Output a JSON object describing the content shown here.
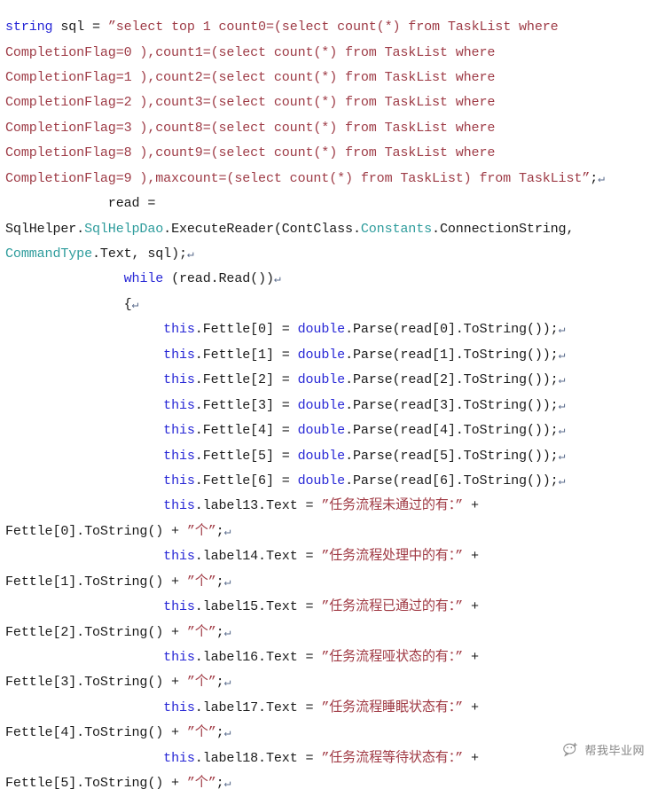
{
  "document": {
    "kind": "source-code-listing",
    "language": "C#",
    "background_color": "#ffffff",
    "colors": {
      "keyword": "#2727d6",
      "string_literal": "#9e3b46",
      "chinese_string": "#a03a44",
      "class_name": "#2e9c9c",
      "plain_text": "#1a1a1a",
      "pilcrow_mark": "#5a6b8c"
    }
  },
  "code": {
    "lines": [
      {
        "n": 1,
        "segments": [
          {
            "t": "string",
            "c": "kw"
          },
          {
            "t": " sql = ",
            "c": "plain"
          },
          {
            "t": "”select top 1 count0=(select count(*) from TaskList where",
            "c": "str"
          }
        ]
      },
      {
        "n": 2,
        "segments": [
          {
            "t": "CompletionFlag=0 ),count1=(select count(*) from TaskList where",
            "c": "str"
          }
        ]
      },
      {
        "n": 3,
        "segments": [
          {
            "t": "CompletionFlag=1 ),count2=(select count(*) from TaskList where",
            "c": "str"
          }
        ]
      },
      {
        "n": 4,
        "segments": [
          {
            "t": "CompletionFlag=2 ),count3=(select count(*) from TaskList where",
            "c": "str"
          }
        ]
      },
      {
        "n": 5,
        "segments": [
          {
            "t": "CompletionFlag=3 ),count8=(select count(*) from TaskList where",
            "c": "str"
          }
        ]
      },
      {
        "n": 6,
        "segments": [
          {
            "t": "CompletionFlag=8 ),count9=(select count(*) from TaskList where",
            "c": "str"
          }
        ]
      },
      {
        "n": 7,
        "segments": [
          {
            "t": "CompletionFlag=9 ),maxcount=(select count(*) from TaskList) from TaskList”",
            "c": "str"
          },
          {
            "t": ";",
            "c": "plain"
          },
          {
            "t": "↵",
            "c": "pil"
          }
        ]
      },
      {
        "n": 8,
        "segments": [
          {
            "t": "             read = ",
            "c": "plain"
          }
        ]
      },
      {
        "n": 9,
        "segments": [
          {
            "t": "SqlHelper.",
            "c": "plain"
          },
          {
            "t": "SqlHelpDao",
            "c": "cls"
          },
          {
            "t": ".ExecuteReader(ContClass.",
            "c": "plain"
          },
          {
            "t": "Constants",
            "c": "cls"
          },
          {
            "t": ".ConnectionString,",
            "c": "plain"
          }
        ]
      },
      {
        "n": 10,
        "segments": [
          {
            "t": "CommandType",
            "c": "cls"
          },
          {
            "t": ".Text, sql);",
            "c": "plain"
          },
          {
            "t": "↵",
            "c": "pil"
          }
        ]
      },
      {
        "n": 11,
        "segments": [
          {
            "t": "               ",
            "c": "plain"
          },
          {
            "t": "while",
            "c": "kw"
          },
          {
            "t": " (read.Read())",
            "c": "plain"
          },
          {
            "t": "↵",
            "c": "pil"
          }
        ]
      },
      {
        "n": 12,
        "segments": [
          {
            "t": "               {",
            "c": "plain"
          },
          {
            "t": "↵",
            "c": "pil"
          }
        ]
      },
      {
        "n": 13,
        "segments": [
          {
            "t": "                    ",
            "c": "plain"
          },
          {
            "t": "this",
            "c": "kw"
          },
          {
            "t": ".Fettle[0] = ",
            "c": "plain"
          },
          {
            "t": "double",
            "c": "kw"
          },
          {
            "t": ".Parse(read[0].ToString());",
            "c": "plain"
          },
          {
            "t": "↵",
            "c": "pil"
          }
        ]
      },
      {
        "n": 14,
        "segments": [
          {
            "t": "                    ",
            "c": "plain"
          },
          {
            "t": "this",
            "c": "kw"
          },
          {
            "t": ".Fettle[1] = ",
            "c": "plain"
          },
          {
            "t": "double",
            "c": "kw"
          },
          {
            "t": ".Parse(read[1].ToString());",
            "c": "plain"
          },
          {
            "t": "↵",
            "c": "pil"
          }
        ]
      },
      {
        "n": 15,
        "segments": [
          {
            "t": "                    ",
            "c": "plain"
          },
          {
            "t": "this",
            "c": "kw"
          },
          {
            "t": ".Fettle[2] = ",
            "c": "plain"
          },
          {
            "t": "double",
            "c": "kw"
          },
          {
            "t": ".Parse(read[2].ToString());",
            "c": "plain"
          },
          {
            "t": "↵",
            "c": "pil"
          }
        ]
      },
      {
        "n": 16,
        "segments": [
          {
            "t": "                    ",
            "c": "plain"
          },
          {
            "t": "this",
            "c": "kw"
          },
          {
            "t": ".Fettle[3] = ",
            "c": "plain"
          },
          {
            "t": "double",
            "c": "kw"
          },
          {
            "t": ".Parse(read[3].ToString());",
            "c": "plain"
          },
          {
            "t": "↵",
            "c": "pil"
          }
        ]
      },
      {
        "n": 17,
        "segments": [
          {
            "t": "                    ",
            "c": "plain"
          },
          {
            "t": "this",
            "c": "kw"
          },
          {
            "t": ".Fettle[4] = ",
            "c": "plain"
          },
          {
            "t": "double",
            "c": "kw"
          },
          {
            "t": ".Parse(read[4].ToString());",
            "c": "plain"
          },
          {
            "t": "↵",
            "c": "pil"
          }
        ]
      },
      {
        "n": 18,
        "segments": [
          {
            "t": "                    ",
            "c": "plain"
          },
          {
            "t": "this",
            "c": "kw"
          },
          {
            "t": ".Fettle[5] = ",
            "c": "plain"
          },
          {
            "t": "double",
            "c": "kw"
          },
          {
            "t": ".Parse(read[5].ToString());",
            "c": "plain"
          },
          {
            "t": "↵",
            "c": "pil"
          }
        ]
      },
      {
        "n": 19,
        "segments": [
          {
            "t": "                    ",
            "c": "plain"
          },
          {
            "t": "this",
            "c": "kw"
          },
          {
            "t": ".Fettle[6] = ",
            "c": "plain"
          },
          {
            "t": "double",
            "c": "kw"
          },
          {
            "t": ".Parse(read[6].ToString());",
            "c": "plain"
          },
          {
            "t": "↵",
            "c": "pil"
          }
        ]
      },
      {
        "n": 20,
        "segments": [
          {
            "t": "                    ",
            "c": "plain"
          },
          {
            "t": "this",
            "c": "kw"
          },
          {
            "t": ".label13.Text = ",
            "c": "plain"
          },
          {
            "t": "”任务流程未通过的有：”",
            "c": "strcn"
          },
          {
            "t": " +",
            "c": "plain"
          }
        ]
      },
      {
        "n": 21,
        "segments": [
          {
            "t": "Fettle[0].ToString() + ",
            "c": "plain"
          },
          {
            "t": "”个”",
            "c": "strcn"
          },
          {
            "t": ";",
            "c": "plain"
          },
          {
            "t": "↵",
            "c": "pil"
          }
        ]
      },
      {
        "n": 22,
        "segments": [
          {
            "t": "                    ",
            "c": "plain"
          },
          {
            "t": "this",
            "c": "kw"
          },
          {
            "t": ".label14.Text = ",
            "c": "plain"
          },
          {
            "t": "”任务流程处理中的有：”",
            "c": "strcn"
          },
          {
            "t": " +",
            "c": "plain"
          }
        ]
      },
      {
        "n": 23,
        "segments": [
          {
            "t": "Fettle[1].ToString() + ",
            "c": "plain"
          },
          {
            "t": "”个”",
            "c": "strcn"
          },
          {
            "t": ";",
            "c": "plain"
          },
          {
            "t": "↵",
            "c": "pil"
          }
        ]
      },
      {
        "n": 24,
        "segments": [
          {
            "t": "                    ",
            "c": "plain"
          },
          {
            "t": "this",
            "c": "kw"
          },
          {
            "t": ".label15.Text = ",
            "c": "plain"
          },
          {
            "t": "”任务流程已通过的有：”",
            "c": "strcn"
          },
          {
            "t": " +",
            "c": "plain"
          }
        ]
      },
      {
        "n": 25,
        "segments": [
          {
            "t": "Fettle[2].ToString() + ",
            "c": "plain"
          },
          {
            "t": "”个”",
            "c": "strcn"
          },
          {
            "t": ";",
            "c": "plain"
          },
          {
            "t": "↵",
            "c": "pil"
          }
        ]
      },
      {
        "n": 26,
        "segments": [
          {
            "t": "                    ",
            "c": "plain"
          },
          {
            "t": "this",
            "c": "kw"
          },
          {
            "t": ".label16.Text = ",
            "c": "plain"
          },
          {
            "t": "”任务流程哑状态的有：”",
            "c": "strcn"
          },
          {
            "t": " +",
            "c": "plain"
          }
        ]
      },
      {
        "n": 27,
        "segments": [
          {
            "t": "Fettle[3].ToString() + ",
            "c": "plain"
          },
          {
            "t": "”个”",
            "c": "strcn"
          },
          {
            "t": ";",
            "c": "plain"
          },
          {
            "t": "↵",
            "c": "pil"
          }
        ]
      },
      {
        "n": 28,
        "segments": [
          {
            "t": "                    ",
            "c": "plain"
          },
          {
            "t": "this",
            "c": "kw"
          },
          {
            "t": ".label17.Text = ",
            "c": "plain"
          },
          {
            "t": "”任务流程睡眠状态有：”",
            "c": "strcn"
          },
          {
            "t": " +",
            "c": "plain"
          }
        ]
      },
      {
        "n": 29,
        "segments": [
          {
            "t": "Fettle[4].ToString() + ",
            "c": "plain"
          },
          {
            "t": "”个”",
            "c": "strcn"
          },
          {
            "t": ";",
            "c": "plain"
          },
          {
            "t": "↵",
            "c": "pil"
          }
        ]
      },
      {
        "n": 30,
        "segments": [
          {
            "t": "                    ",
            "c": "plain"
          },
          {
            "t": "this",
            "c": "kw"
          },
          {
            "t": ".label18.Text = ",
            "c": "plain"
          },
          {
            "t": "”任务流程等待状态有：”",
            "c": "strcn"
          },
          {
            "t": " +",
            "c": "plain"
          }
        ]
      },
      {
        "n": 31,
        "segments": [
          {
            "t": "Fettle[5].ToString() + ",
            "c": "plain"
          },
          {
            "t": "”个”",
            "c": "strcn"
          },
          {
            "t": ";",
            "c": "plain"
          },
          {
            "t": "↵",
            "c": "pil"
          }
        ]
      }
    ]
  },
  "watermark": {
    "text": "帮我毕业网",
    "icon": "wechat-icon"
  }
}
